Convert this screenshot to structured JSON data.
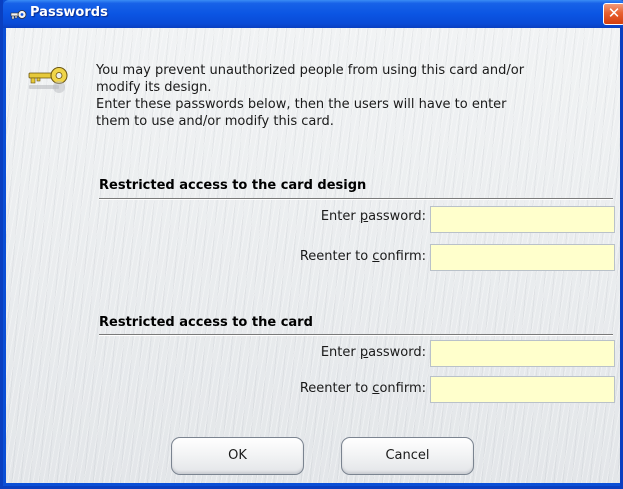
{
  "window": {
    "title": "Passwords",
    "title_icon": "keys-icon",
    "close_label": "✕"
  },
  "intro": {
    "icon": "key-icon",
    "line1": "You may prevent unauthorized people from using this card and/or",
    "line2": "modify its design.",
    "line3": "Enter these passwords below, then the users will have to enter",
    "line4": "them to use and/or modify this card."
  },
  "design_section": {
    "title": "Restricted access to the card design",
    "password_label_pre": "Enter ",
    "password_label_u": "p",
    "password_label_post": "assword:",
    "password_value": "",
    "confirm_label_pre": "Reenter to ",
    "confirm_label_u": "c",
    "confirm_label_post": "onfirm:",
    "confirm_value": ""
  },
  "card_section": {
    "title": "Restricted access to the card",
    "password_label_pre": "Enter ",
    "password_label_u": "p",
    "password_label_post": "assword:",
    "password_value": "",
    "confirm_label_pre": "Reenter to ",
    "confirm_label_u": "c",
    "confirm_label_post": "onfirm:",
    "confirm_value": ""
  },
  "buttons": {
    "ok": "OK",
    "cancel": "Cancel"
  },
  "colors": {
    "titlebar": "#0b55e3",
    "input_background": "#ffffcc",
    "close_button": "#e8602f"
  }
}
